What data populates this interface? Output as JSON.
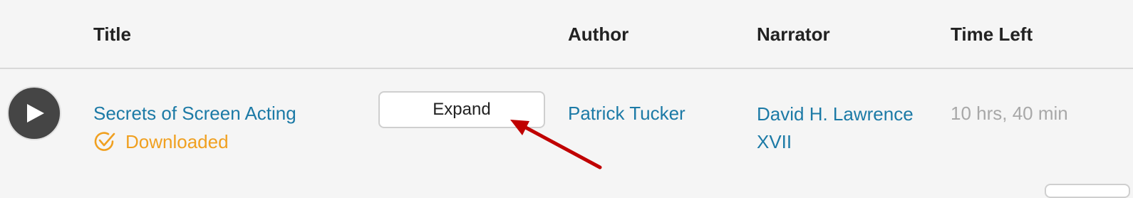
{
  "header": {
    "title": "Title",
    "author": "Author",
    "narrator": "Narrator",
    "time_left": "Time Left"
  },
  "row": {
    "title": "Secrets of Screen Acting",
    "status": "Downloaded",
    "expand_label": "Expand",
    "author": "Patrick Tucker",
    "narrator": "David H. Lawrence XVII",
    "time_left": "10 hrs, 40 min"
  },
  "icons": {
    "play": "play-icon",
    "downloaded": "check-circle-icon",
    "annotation": "red-arrow"
  },
  "colors": {
    "link": "#1c7aa6",
    "status": "#f0a020",
    "muted": "#a8a8a8",
    "play_bg": "#454545",
    "arrow": "#c00000"
  }
}
